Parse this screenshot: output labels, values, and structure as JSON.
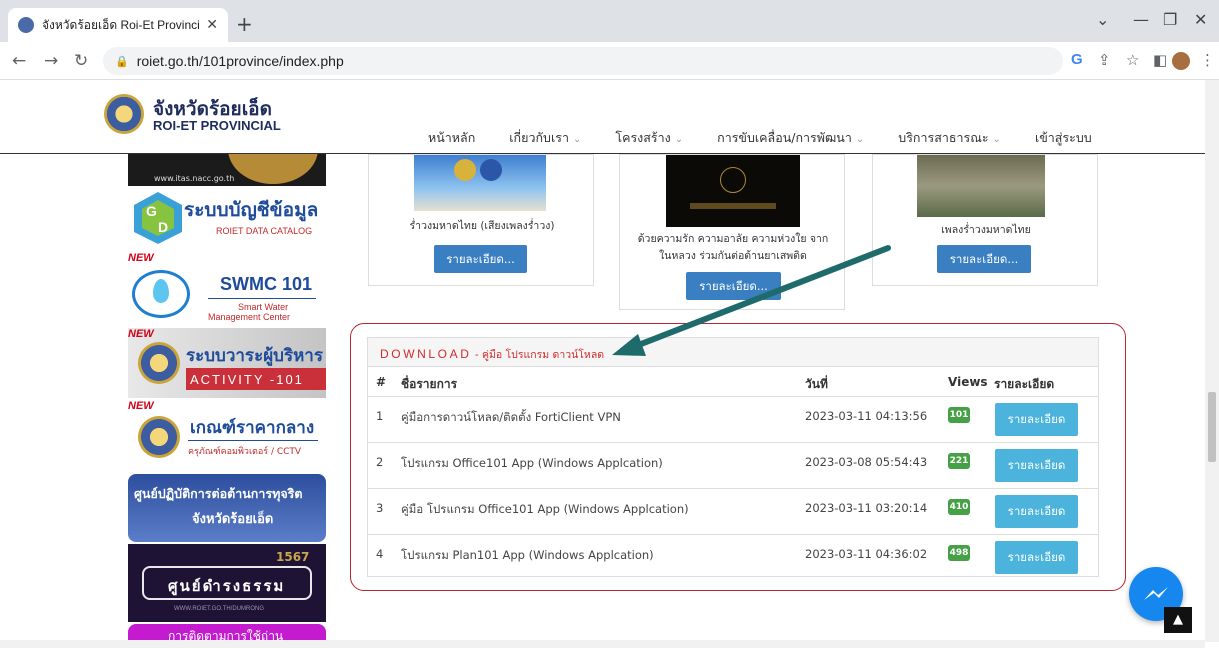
{
  "browser": {
    "tab_title": "จังหวัดร้อยเอ็ด Roi-Et Provincial",
    "new_tab": "+",
    "url": "roiet.go.th/101province/index.php"
  },
  "site": {
    "title_th": "จังหวัดร้อยเอ็ด",
    "title_en": "ROI-ET PROVINCIAL",
    "menu": [
      {
        "label": "หน้าหลัก",
        "chevron": false
      },
      {
        "label": "เกี่ยวกับเรา",
        "chevron": true
      },
      {
        "label": "โครงสร้าง",
        "chevron": true
      },
      {
        "label": "การขับเคลื่อน/การพัฒนา",
        "chevron": true
      },
      {
        "label": "บริการสาธารณะ",
        "chevron": true
      },
      {
        "label": "เข้าสู่ระบบ",
        "chevron": false
      }
    ]
  },
  "sidebar": {
    "itas": "www.itas.nacc.go.th",
    "gd_title": "ระบบบัญชีข้อมูล",
    "gd_sub": "ROIET DATA CATALOG",
    "swmc_title": "SWMC 101",
    "swmc_sub1": "Smart Water",
    "swmc_sub2": "Management Center",
    "new": "NEW",
    "ceo_title": "ระบบวาระผู้บริหาร",
    "ceo_sub": "ACTIVITY -101",
    "price_title": "เกณฑ์ราคากลาง",
    "price_sub": "ครุภัณฑ์คอมพิวเตอร์ / CCTV",
    "anti_title1": "ศูนย์ปฏิบัติการต่อต้านการทุจริต",
    "anti_title2": "จังหวัดร้อยเอ็ด",
    "dam_num": "1567",
    "dam_title": "ศูนย์ดำรงธรรม",
    "dam_url": "WWW.ROIET.GO.TH/DUMRONG",
    "last_title": "การติดตามการใช้ถ่าน"
  },
  "cards": [
    {
      "caption": "ร่ำวงมหาดไทย (เสียงเพลงร่ำวง)",
      "button": "รายละเอียด..."
    },
    {
      "caption": "ด้วยความรัก ความอาลัย ความห่วงใย จาก ในหลวง ร่วมกันต่อต้านยาเสพติด",
      "button": "รายละเอียด..."
    },
    {
      "caption": "เพลงร่ำวงมหาดไทย",
      "button": "รายละเอียด..."
    }
  ],
  "download": {
    "heading": "DOWNLOAD",
    "sub": " - คู่มือ โปรแกรม ดาวน์โหลด",
    "columns": {
      "num": "#",
      "name": "ชื่อรายการ",
      "date": "วันที่",
      "views": "Views",
      "detail": "รายละเอียด"
    },
    "rows": [
      {
        "num": "1",
        "name": "คู่มือการดาวน์โหลด/ติดตั้ง FortiClient VPN",
        "date": "2023-03-11 04:13:56",
        "views": "101",
        "button": "รายละเอียด"
      },
      {
        "num": "2",
        "name": "โปรแกรม Office101 App (Windows Applcation)",
        "date": "2023-03-08 05:54:43",
        "views": "221",
        "button": "รายละเอียด"
      },
      {
        "num": "3",
        "name": "คู่มือ โปรแกรม Office101 App (Windows Applcation)",
        "date": "2023-03-11 03:20:14",
        "views": "410",
        "button": "รายละเอียด"
      },
      {
        "num": "4",
        "name": "โปรแกรม Plan101 App (Windows Applcation)",
        "date": "2023-03-11 04:36:02",
        "views": "498",
        "button": "รายละเอียด"
      }
    ]
  },
  "colors": {
    "accent": "#3a7fc2",
    "badge": "#46a046",
    "detail_button": "#4bb3dc",
    "highlight": "#b5262f",
    "arrow": "#1f6b6b"
  }
}
